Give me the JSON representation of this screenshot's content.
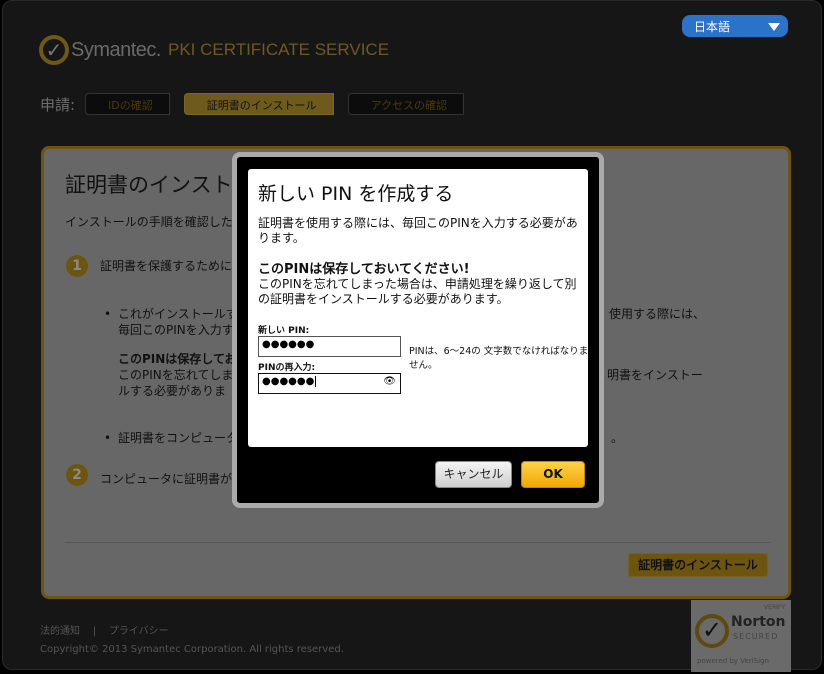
{
  "header": {
    "language": "日本語",
    "brand": "Symantec.",
    "service": "PKI CERTIFICATE SERVICE"
  },
  "steps": {
    "label": "申請:",
    "items": [
      "IDの確認",
      "証明書のインストール",
      "アクセスの確認"
    ]
  },
  "panel": {
    "title": "証明書のインストー",
    "intro": "インストールの手順を確認した後",
    "step1_num": "1",
    "step1_text": "証明書を保護するために",
    "bullet1_line1": "これがインストールす",
    "bullet1_line1_right": "使用する際には、",
    "bullet1_line2": "毎回このPINを入力す",
    "bold_note": "このPINは保存してお",
    "note_line1": "このPINを忘れてしま",
    "note_line1_right": "明書をインストー",
    "note_line2": "ルする必要がありま",
    "bullet2": "証明書をコンピュータ",
    "bullet2_right": "。",
    "step2_num": "2",
    "step2_text": "コンピュータに証明書が",
    "install_button": "証明書のインストール"
  },
  "footer": {
    "legal": "法的通知",
    "sep": "|",
    "privacy": "プライバシー",
    "copyright": "Copyright© 2013 Symantec Corporation. All rights reserved."
  },
  "norton": {
    "verify": "VERIFY",
    "name": "Norton",
    "secured": "SECURED",
    "powered": "powered by VeriSign"
  },
  "modal": {
    "title": "新しい PIN を作成する",
    "desc": "証明書を使用する際には、毎回このPINを入力する必要があります。",
    "warning": "このPINは保存しておいてください!",
    "warning_text": "このPINを忘れてしまった場合は、申請処理を繰り返して別の証明書をインストールする必要があります。",
    "new_pin_label": "新しい PIN:",
    "new_pin_value": "●●●●●●",
    "confirm_label": "PINの再入力:",
    "confirm_value": "●●●●●●",
    "hint": "PINは、6〜24の 文字数でなければなりません。",
    "cancel": "キャンセル",
    "ok": "OK"
  }
}
